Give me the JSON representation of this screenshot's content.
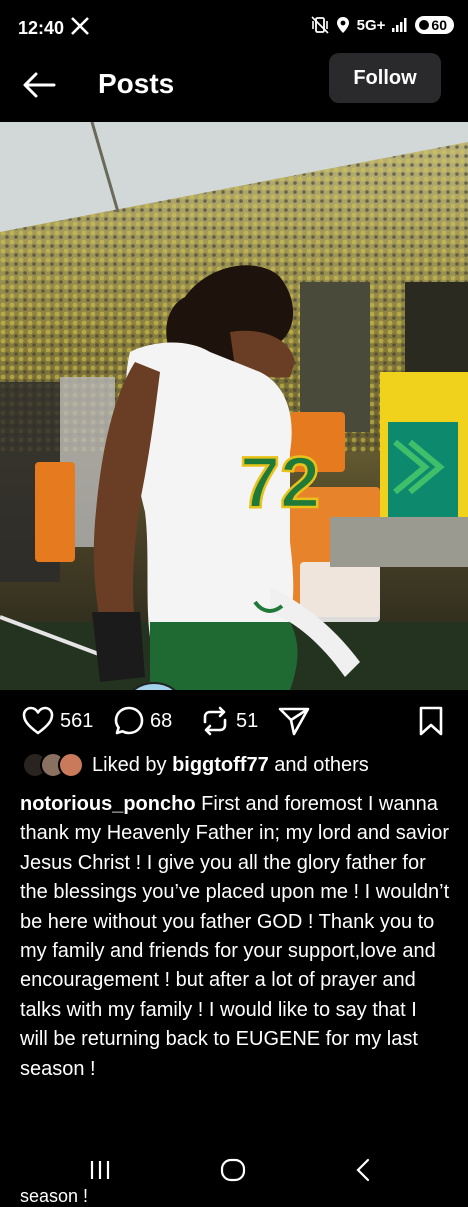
{
  "status_bar": {
    "time": "12:40",
    "network": "5G+",
    "battery": "60",
    "icons": [
      "x-logo-icon",
      "vibrate-icon",
      "location-icon",
      "signal-icon",
      "battery-icon"
    ]
  },
  "header": {
    "title": "Posts",
    "follow_label": "Follow"
  },
  "post": {
    "likes_count": "561",
    "comments_count": "68",
    "reposts_count": "51",
    "liked_by_prefix": "Liked by ",
    "liked_by_user": "biggtoff77",
    "liked_by_suffix": " and others",
    "author": "notorious_poncho",
    "caption": " First and foremost I wanna thank my Heavenly Father in; my lord and savior Jesus Christ !  I give you all the glory father for the blessings you’ve placed upon me ! I wouldn’t be here without you father GOD ! Thank you to my family and friends for your support,love and encouragement ! but after a lot of prayer and talks with my family ! I would like to say that I will be returning back to EUGENE for my last season !",
    "jersey_number": "72",
    "cut_off_text": "season !"
  },
  "colors": {
    "background": "#000000",
    "follow_bg": "#2a2a2c",
    "repost_badge": "#8b5cf6",
    "jersey_green": "#1f7a3a",
    "jersey_yellow": "#e8c21a"
  }
}
